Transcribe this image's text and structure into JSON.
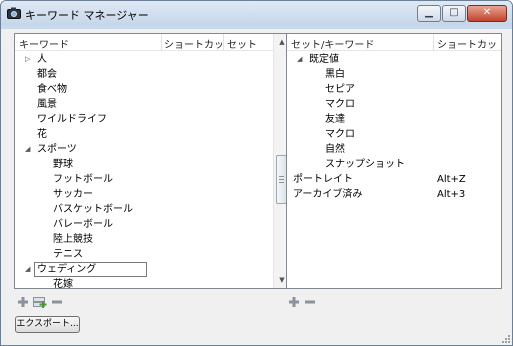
{
  "window": {
    "title": "キーワード マネージャー"
  },
  "window_buttons": {
    "minimize": "▁",
    "maximize": "□",
    "close": "✕"
  },
  "left": {
    "headers": {
      "keyword": "キーワード",
      "shortcut": "ショートカッ",
      "set": "セット"
    },
    "rows": [
      {
        "label": "人",
        "indent": 1,
        "tri": "▷"
      },
      {
        "label": "都会",
        "indent": 1,
        "tri": ""
      },
      {
        "label": "食べ物",
        "indent": 1,
        "tri": ""
      },
      {
        "label": "風景",
        "indent": 1,
        "tri": ""
      },
      {
        "label": "ワイルドライフ",
        "indent": 1,
        "tri": ""
      },
      {
        "label": "花",
        "indent": 1,
        "tri": ""
      },
      {
        "label": "スポーツ",
        "indent": 1,
        "tri": "◢"
      },
      {
        "label": "野球",
        "indent": 2,
        "tri": ""
      },
      {
        "label": "フットボール",
        "indent": 2,
        "tri": ""
      },
      {
        "label": "サッカー",
        "indent": 2,
        "tri": ""
      },
      {
        "label": "バスケットボール",
        "indent": 2,
        "tri": ""
      },
      {
        "label": "バレーボール",
        "indent": 2,
        "tri": ""
      },
      {
        "label": "陸上競技",
        "indent": 2,
        "tri": ""
      },
      {
        "label": "テニス",
        "indent": 2,
        "tri": ""
      },
      {
        "label": "ウェディング",
        "indent": 1,
        "tri": "◢",
        "editing": true
      },
      {
        "label": "花嫁",
        "indent": 2,
        "tri": ""
      }
    ]
  },
  "right": {
    "headers": {
      "set_keyword": "セット/キーワード",
      "shortcut": "ショートカッ"
    },
    "rows": [
      {
        "label": "既定値",
        "shortcut": "",
        "indent": 1,
        "tri": "◢"
      },
      {
        "label": "黒白",
        "shortcut": "",
        "indent": 2,
        "tri": ""
      },
      {
        "label": "セピア",
        "shortcut": "",
        "indent": 2,
        "tri": ""
      },
      {
        "label": "マクロ",
        "shortcut": "",
        "indent": 2,
        "tri": ""
      },
      {
        "label": "友達",
        "shortcut": "",
        "indent": 2,
        "tri": ""
      },
      {
        "label": "マクロ",
        "shortcut": "",
        "indent": 2,
        "tri": ""
      },
      {
        "label": "自然",
        "shortcut": "",
        "indent": 2,
        "tri": ""
      },
      {
        "label": "スナップショット",
        "shortcut": "",
        "indent": 2,
        "tri": ""
      },
      {
        "label": "ポートレイト",
        "shortcut": "Alt+Z",
        "indent": 0,
        "tri": ""
      },
      {
        "label": "アーカイブ済み",
        "shortcut": "Alt+3",
        "indent": 0,
        "tri": ""
      }
    ]
  },
  "toolbar": {
    "add_icon": "plus-icon",
    "add_set_icon": "add-set-icon",
    "remove_icon": "minus-icon"
  },
  "export": {
    "label": "エクスポート..."
  },
  "scrollbar": {
    "up": "▲",
    "down": "▼"
  },
  "colors": {
    "accent_green": "#4a9a2f",
    "border": "#828790"
  }
}
